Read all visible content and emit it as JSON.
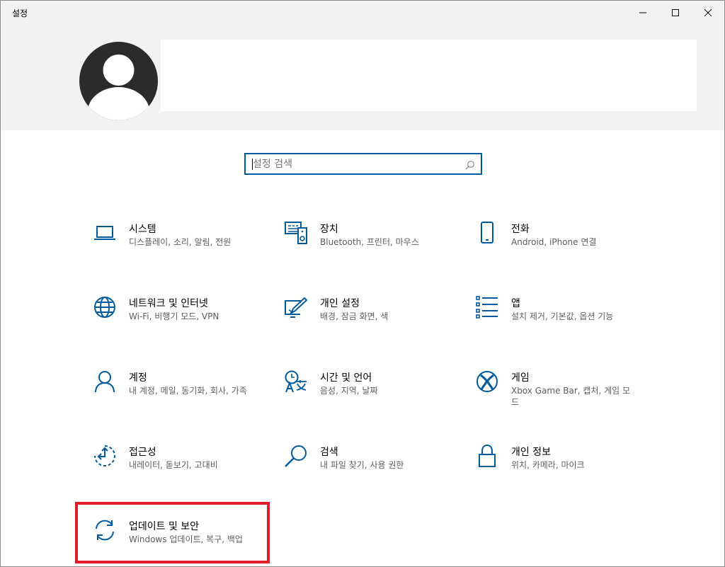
{
  "window": {
    "title": "설정"
  },
  "search": {
    "placeholder": "설정 검색"
  },
  "tiles": [
    {
      "title": "시스템",
      "subtitle": "디스플레이, 소리, 알림, 전원",
      "icon": "laptop-icon"
    },
    {
      "title": "장치",
      "subtitle": "Bluetooth, 프린터, 마우스",
      "icon": "devices-icon"
    },
    {
      "title": "전화",
      "subtitle": "Android, iPhone 연결",
      "icon": "phone-icon"
    },
    {
      "title": "네트워크 및 인터넷",
      "subtitle": "Wi-Fi, 비행기 모드, VPN",
      "icon": "globe-icon"
    },
    {
      "title": "개인 설정",
      "subtitle": "배경, 잠금 화면, 색",
      "icon": "personalization-icon"
    },
    {
      "title": "앱",
      "subtitle": "설치 제거, 기본값, 옵션 기능",
      "icon": "apps-list-icon"
    },
    {
      "title": "계정",
      "subtitle": "내 계정, 메일, 동기화, 회사, 가족",
      "icon": "person-icon"
    },
    {
      "title": "시간 및 언어",
      "subtitle": "음성, 지역, 날짜",
      "icon": "time-language-icon"
    },
    {
      "title": "게임",
      "subtitle": "Xbox Game Bar, 캡처, 게임 모드",
      "icon": "xbox-icon"
    },
    {
      "title": "접근성",
      "subtitle": "내레이터, 돋보기, 고대비",
      "icon": "ease-of-access-icon"
    },
    {
      "title": "검색",
      "subtitle": "내 파일 찾기, 사용 권한",
      "icon": "search-magnifier-icon"
    },
    {
      "title": "개인 정보",
      "subtitle": "위치, 카메라, 마이크",
      "icon": "lock-icon"
    },
    {
      "title": "업데이트 및 보안",
      "subtitle": "Windows 업데이트, 복구, 백업",
      "icon": "sync-icon"
    }
  ],
  "colors": {
    "accent": "#005a9e",
    "highlight": "#e01e2b",
    "header_bg": "#f2f2f2"
  }
}
